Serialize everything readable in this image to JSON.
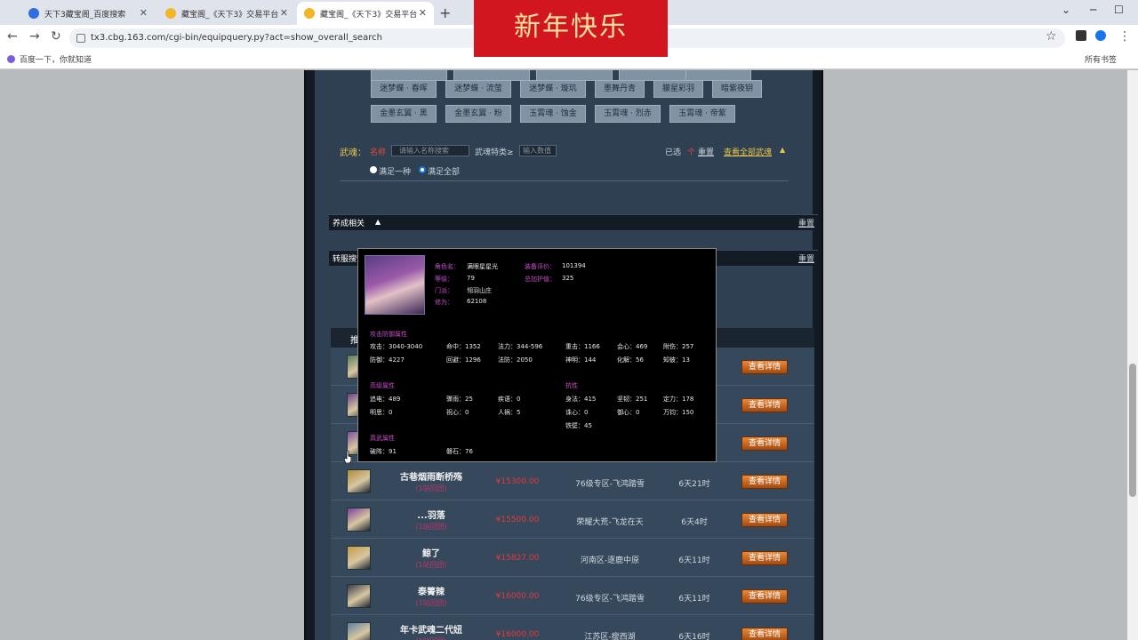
{
  "browser": {
    "tabs": [
      {
        "title": "天下3藏宝阁_百度搜索",
        "favicon": "baidu-favicon"
      },
      {
        "title": "藏宝阁_《天下3》交易平台",
        "favicon": "cbg-favicon"
      },
      {
        "title": "藏宝阁_《天下3》交易平台",
        "favicon": "cbg-favicon"
      }
    ],
    "new_tab": "+",
    "url": "tx3.cbg.163.com/cgi-bin/equipquery.py?act=show_overall_search",
    "bookmark": "百度一下，你就知道",
    "all_bookmarks": "所有书签",
    "banner": "新年快乐"
  },
  "skins": {
    "row1": [
      "迷梦蝶 · 春晖",
      "迷梦蝶 · 流萤",
      "迷梦蝶 · 璇玑",
      "墨舞丹青",
      "朦星彩羽",
      "暗紫夜钥"
    ],
    "row2": [
      "金墨玄翼 · 黑",
      "金墨玄翼 · 粉",
      "玉霄魂 · 蚀金",
      "玉霄魂 · 烈赤",
      "玉霄魂 · 帝紫"
    ]
  },
  "wuhun": {
    "label": "武魂：",
    "red_label": "名称",
    "name_placeholder": "请输入名称搜索",
    "type_label": "武魂特类≥",
    "value_placeholder": "输入数值",
    "selected": "已选",
    "selected_count": "个",
    "reset": "重置",
    "view_all": "查看全部武魂",
    "radio_one": "满足一种",
    "radio_all": "满足全部"
  },
  "sections": {
    "yangcheng": "养成相关",
    "zhuanfu": "转服搜索",
    "reset": "重置",
    "table_header": "推荐"
  },
  "popup": {
    "role_name_label": "角色名：",
    "role_name": "满眼星星光",
    "level_label": "等级：",
    "level": "79",
    "school_label": "门派：",
    "school": "翎羽山庄",
    "cultivation_label": "修为：",
    "cultivation": "62108",
    "equip_score_label": "装备评价：",
    "equip_score": "101394",
    "total_protect_label": "总加护值：",
    "total_protect": "325",
    "attack_defense_title": "攻击防御属性",
    "attack": "攻击：3040-3040",
    "hit": "命中：1352",
    "magic": "法力：344-596",
    "heavy": "重击：1166",
    "heart": "会心：469",
    "aux_defense": "附伤：257",
    "defense": "防御：4227",
    "dodge": "回避：1296",
    "magic_def": "法防：2050",
    "fortitude": "神明：144",
    "resolve": "化解：56",
    "insight": "知彼：13",
    "advanced_title": "高级属性",
    "penetrate": "追电：489",
    "hurt": "骤雨：25",
    "sudden": "疾语：0",
    "clear": "明思：0",
    "heartcalm": "祝心：0",
    "human": "人祸：5",
    "resist_title": "抗性",
    "body": "身法：415",
    "firm": "坚韧：251",
    "calm": "定力：178",
    "mind": "诛心：0",
    "soul": "御心：0",
    "myriad": "万钧：150",
    "iron": "铁壁：45",
    "true_martial_title": "真武属性",
    "break_formation": "破阵：91",
    "stone": "磐石：76"
  },
  "listing": [
    {
      "name": "",
      "sub": "",
      "price": "",
      "server": "",
      "time": "",
      "button": "查看详情",
      "avatar": "#5a7a5c"
    },
    {
      "name": "",
      "sub": "",
      "price": "",
      "server": "",
      "time": "",
      "button": "查看详情",
      "avatar": "#6a3f8a"
    },
    {
      "name": "",
      "sub": "",
      "price": "",
      "server": "",
      "time": "",
      "button": "查看详情",
      "avatar": "#7b4fa0"
    },
    {
      "name": "古巷烟雨断桥殇",
      "sub": "(1站回团)",
      "price": "¥15300.00",
      "server": "76级专区-飞鸿踏雪",
      "time": "6天21时",
      "button": "查看详情",
      "avatar": "#b08a3c"
    },
    {
      "name": "...羽落",
      "sub": "(1站回团)",
      "price": "¥15500.00",
      "server": "荣耀大荒-飞龙在天",
      "time": "6天4时",
      "button": "查看详情",
      "avatar": "#7a3f9a"
    },
    {
      "name": "鲸了",
      "sub": "(1站回团)",
      "price": "¥15827.00",
      "server": "河南区-逐鹿中原",
      "time": "6天11时",
      "button": "查看详情",
      "avatar": "#c59a4a"
    },
    {
      "name": "泰箐辣",
      "sub": "(1站回团)",
      "price": "¥16000.00",
      "server": "76级专区-飞鸿踏雪",
      "time": "6天11时",
      "button": "查看详情",
      "avatar": "#3a3a4a"
    },
    {
      "name": "年卡武魂二代妞",
      "sub": "(1站回团)",
      "price": "¥16000.00",
      "server": "江苏区-瘦西湖",
      "time": "6天16时",
      "button": "查看详情",
      "avatar": "#5f7fa0"
    }
  ]
}
